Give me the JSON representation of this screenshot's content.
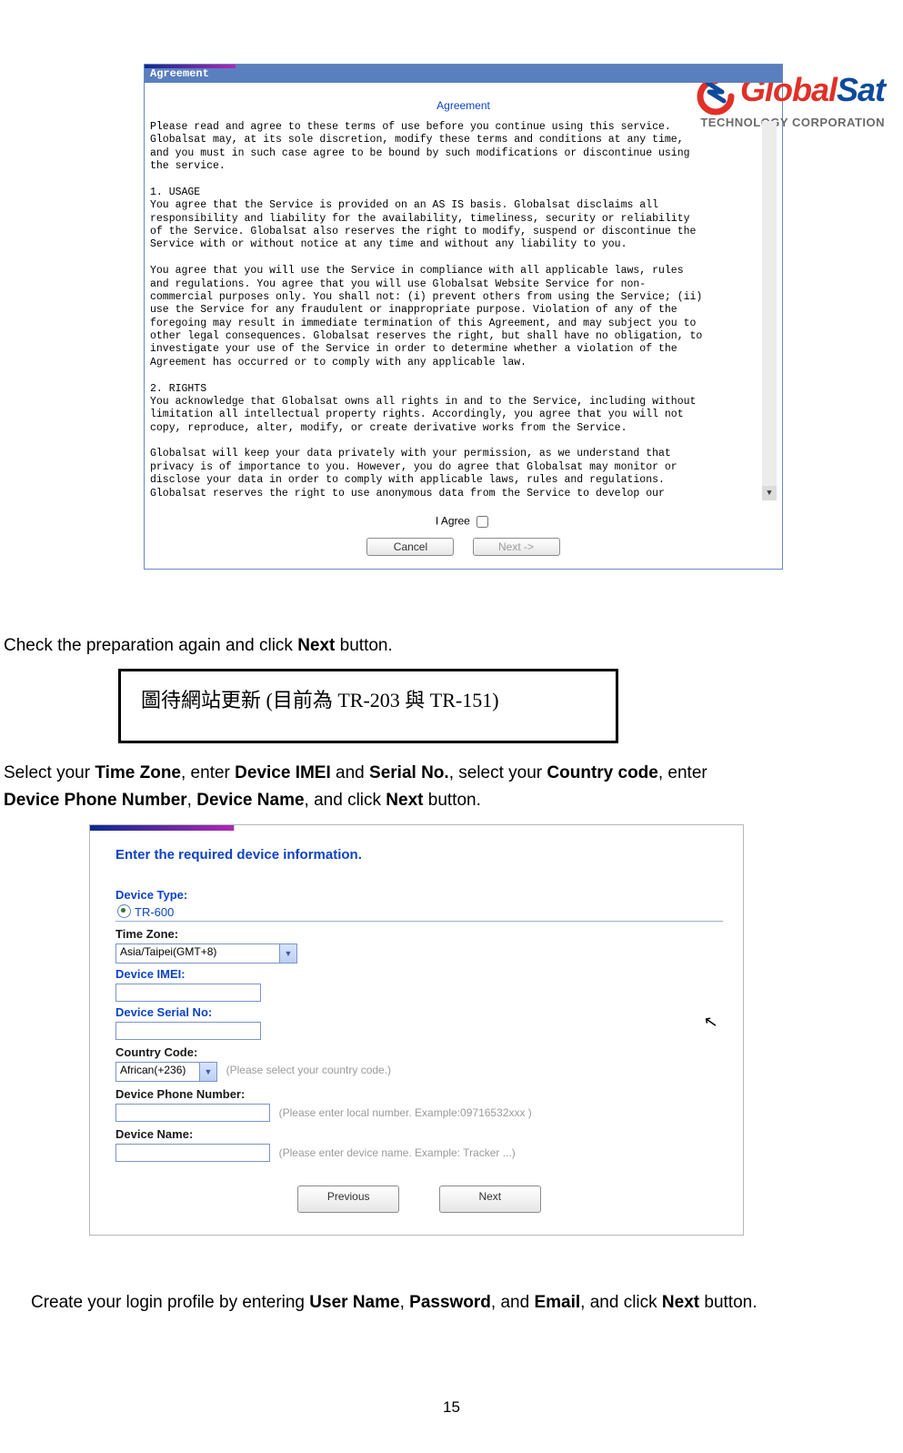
{
  "logo": {
    "brand_part1": "Global",
    "brand_part2": "Sat",
    "subtitle": "TECHNOLOGY CORPORATION"
  },
  "agreement": {
    "tab_title": "Agreement",
    "center_title": "Agreement",
    "text": "Please read and agree to these terms of use before you continue using this service.\nGlobalsat may, at its sole discretion, modify these terms and conditions at any time,\nand you must in such case agree to be bound by such modifications or discontinue using\nthe service.\n\n1. USAGE\nYou agree that the Service is provided on an AS IS basis. Globalsat disclaims all\nresponsibility and liability for the availability, timeliness, security or reliability\nof the Service. Globalsat also reserves the right to modify, suspend or discontinue the\nService with or without notice at any time and without any liability to you.\n\nYou agree that you will use the Service in compliance with all applicable laws, rules\nand regulations. You agree that you will use Globalsat Website Service for non-\ncommercial purposes only. You shall not: (i) prevent others from using the Service; (ii)\nuse the Service for any fraudulent or inappropriate purpose. Violation of any of the\nforegoing may result in immediate termination of this Agreement, and may subject you to\nother legal consequences. Globalsat reserves the right, but shall have no obligation, to\ninvestigate your use of the Service in order to determine whether a violation of the\nAgreement has occurred or to comply with any applicable law.\n\n2. RIGHTS\nYou acknowledge that Globalsat owns all rights in and to the Service, including without\nlimitation all intellectual property rights. Accordingly, you agree that you will not\ncopy, reproduce, alter, modify, or create derivative works from the Service.\n\nGlobalsat will keep your data privately with your permission, as we understand that\nprivacy is of importance to you. However, you do agree that Globalsat may monitor or\ndisclose your data in order to comply with applicable laws, rules and regulations.\nGlobalsat reserves the right to use anonymous data from the Service to develop our",
    "agree_label": "I Agree",
    "cancel_label": "Cancel",
    "next_label": "Next ->"
  },
  "para1": {
    "pre": "Check the preparation again and click ",
    "b1": "Next",
    "post": " button."
  },
  "placeholder_note": "圖待網站更新 (目前為 TR-203 與 TR-151)",
  "para2": {
    "t1": "Select your ",
    "b1": "Time Zone",
    "t2": ", enter ",
    "b2": "Device IMEI",
    "t3": " and ",
    "b3": "Serial No.",
    "t4": ", select your ",
    "b4": "Country code",
    "t5": ", enter ",
    "b5": "Device Phone Number",
    "t6": ", ",
    "b6": "Device Name",
    "t7": ", and click ",
    "b7": "Next",
    "t8": " button."
  },
  "dev": {
    "lead": "Enter the required device information.",
    "device_type_label": "Device Type:",
    "device_type_value": "TR-600",
    "timezone_label": "Time Zone:",
    "timezone_value": "Asia/Taipei(GMT+8)",
    "imei_label": "Device IMEI:",
    "serial_label": "Device Serial No:",
    "country_label": "Country Code:",
    "country_value": "African(+236)",
    "country_hint": "(Please select your country code.)",
    "phone_label": "Device Phone Number:",
    "phone_hint": "(Please enter local number. Example:09716532xxx )",
    "name_label": "Device Name:",
    "name_hint": "(Please enter device name. Example: Tracker ...)",
    "prev_btn": "Previous",
    "next_btn": "Next"
  },
  "para3": {
    "t1": "Create your login profile by entering ",
    "b1": "User Name",
    "t2": ", ",
    "b2": "Password",
    "t3": ", and ",
    "b3": "Email",
    "t4": ", and click ",
    "b4": "Next",
    "t5": " button."
  },
  "page_number": "15"
}
